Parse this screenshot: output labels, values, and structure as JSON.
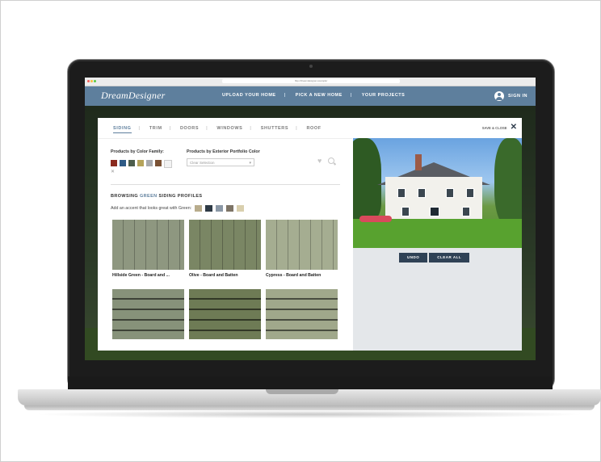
{
  "browser": {
    "url": "http://dreamdesigner.example/"
  },
  "site": {
    "logo": "DreamDesigner",
    "nav": [
      "UPLOAD YOUR HOME",
      "PICK A NEW HOME",
      "YOUR PROJECTS"
    ],
    "sign_in": "SIGN IN"
  },
  "modal": {
    "tabs": [
      "SIDING",
      "TRIM",
      "DOORS",
      "WINDOWS",
      "SHUTTERS",
      "ROOF"
    ],
    "active_tab": "SIDING",
    "save_close": "SAVE & CLOSE",
    "color_family_label": "Products by Color Family:",
    "color_family_swatches": [
      "#8a2a1e",
      "#2f5b86",
      "#4d5e4c",
      "#b5a35a",
      "#a7a9ad",
      "#7a5134",
      "#f2f2f2"
    ],
    "portfolio_label": "Products by Exterior Portfolio Color",
    "portfolio_placeholder": "Clear Selection",
    "browsing_prefix": "BROWSING ",
    "browsing_color": "GREEN",
    "browsing_suffix": " SIDING PROFILES",
    "accent_label": "Add an accent that looks great with Green:",
    "accent_swatches": [
      "#b8ac8c",
      "#2e3a45",
      "#8b98a6",
      "#7d7466",
      "#d9cfae"
    ],
    "products": [
      {
        "name": "Hillside Green - Board and ...",
        "color": "#8e9780",
        "style": "board-and-batten"
      },
      {
        "name": "Olive - Board and Batten",
        "color": "#7a8664",
        "style": "board-and-batten"
      },
      {
        "name": "Cypress - Board and Batten",
        "color": "#a5ad91",
        "style": "board-and-batten"
      },
      {
        "name": "",
        "color": "#87927a",
        "style": "lap"
      },
      {
        "name": "",
        "color": "#6e7b55",
        "style": "lap"
      },
      {
        "name": "",
        "color": "#a0a88b",
        "style": "lap"
      }
    ],
    "undo": "UNDO",
    "clear_all": "CLEAR ALL"
  }
}
